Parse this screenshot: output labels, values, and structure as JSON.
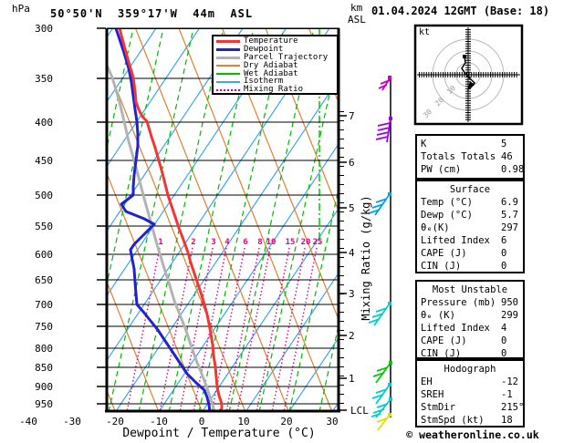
{
  "header": {
    "pressure_unit": "hPa",
    "title": "50°50'N  359°17'W  44m  ASL",
    "km_label": "km",
    "asl_label": "ASL",
    "date": "01.04.2024 12GMT (Base: 18)"
  },
  "legend": {
    "items": [
      {
        "label": "Temperature",
        "color": "#f23535"
      },
      {
        "label": "Dewpoint",
        "color": "#2222cc"
      },
      {
        "label": "Parcel Trajectory",
        "color": "#b3b3b3"
      },
      {
        "label": "Dry Adiabat",
        "color": "#e08030"
      },
      {
        "label": "Wet Adiabat",
        "color": "#00bb00"
      },
      {
        "label": "Isotherm",
        "color": "#3ba6f2"
      },
      {
        "label": "Mixing Ratio",
        "color": "#e0007d"
      }
    ]
  },
  "axes": {
    "pressure": [
      "300",
      "350",
      "400",
      "450",
      "500",
      "550",
      "600",
      "650",
      "700",
      "750",
      "800",
      "850",
      "900",
      "950"
    ],
    "temp": [
      "-40",
      "-30",
      "-20",
      "-10",
      "0",
      "10",
      "20",
      "30"
    ],
    "km": [
      "7",
      "6",
      "5",
      "4",
      "3",
      "2",
      "1"
    ],
    "lcl": "LCL",
    "mix": [
      "1",
      "2",
      "3",
      "4",
      "6",
      "8",
      "10",
      "15",
      "20",
      "25"
    ],
    "xlabel": "Dewpoint / Temperature (°C)",
    "ylabel_right": "Mixing Ratio (g/kg)"
  },
  "hodograph": {
    "unit": "kt",
    "rings": [
      "10",
      "20",
      "30"
    ]
  },
  "panels": {
    "indices": {
      "rows": [
        {
          "label": "K",
          "value": "5"
        },
        {
          "label": "Totals Totals",
          "value": "46"
        },
        {
          "label": "PW (cm)",
          "value": "0.98"
        }
      ]
    },
    "surface": {
      "title": "Surface",
      "rows": [
        {
          "label": "Temp (°C)",
          "value": "6.9"
        },
        {
          "label": "Dewp (°C)",
          "value": "5.7"
        },
        {
          "label": "θₑ(K)",
          "value": "297"
        },
        {
          "label": "Lifted Index",
          "value": "6"
        },
        {
          "label": "CAPE (J)",
          "value": "0"
        },
        {
          "label": "CIN (J)",
          "value": "0"
        }
      ]
    },
    "most_unstable": {
      "title": "Most Unstable",
      "rows": [
        {
          "label": "Pressure (mb)",
          "value": "950"
        },
        {
          "label": "θₑ (K)",
          "value": "299"
        },
        {
          "label": "Lifted Index",
          "value": "4"
        },
        {
          "label": "CAPE (J)",
          "value": "0"
        },
        {
          "label": "CIN (J)",
          "value": "0"
        }
      ]
    },
    "hodograph_stats": {
      "title": "Hodograph",
      "rows": [
        {
          "label": "EH",
          "value": "-12"
        },
        {
          "label": "SREH",
          "value": "-1"
        },
        {
          "label": "StmDir",
          "value": "215°"
        },
        {
          "label": "StmSpd (kt)",
          "value": "18"
        }
      ]
    }
  },
  "footer": {
    "copyright": "© weatheronline.co.uk"
  },
  "colors": {
    "temperature": "#f23535",
    "dewpoint": "#2222cc",
    "parcel": "#b3b3b3",
    "dry_adiabat": "#e08030",
    "wet_adiabat": "#00bb00",
    "isotherm": "#3ba6f2",
    "mixing_ratio": "#e0007d",
    "barb_magenta": "#cc00cc",
    "barb_purple": "#9900ee",
    "barb_blue": "#00a2e8",
    "barb_teal": "#00cdcd",
    "barb_green": "#00cc00",
    "barb_yellow": "#dfdf00"
  },
  "chart_data": {
    "type": "skew-t",
    "station": "50°50'N 359°17'W 44m ASL",
    "valid": "01.04.2024 12GMT (Base: 18)",
    "pressure_levels_hpa": [
      950,
      900,
      850,
      800,
      750,
      700,
      650,
      600,
      550,
      500,
      450,
      400,
      350,
      300
    ],
    "temperature_c": [
      6.9,
      4,
      1,
      -2,
      -5,
      -9,
      -13,
      -17,
      -21,
      -26,
      -31,
      -37,
      -44,
      -52
    ],
    "dewpoint_c": [
      5.7,
      2,
      -3,
      -8,
      -14,
      -19,
      -22,
      -27,
      -24,
      -33,
      -38,
      -45,
      -52,
      -60
    ],
    "mixing_ratio_lines_g_kg": [
      1,
      2,
      3,
      4,
      6,
      8,
      10,
      15,
      20,
      25
    ],
    "temp_axis_range_c": [
      -40,
      38
    ],
    "pressure_axis_range_hpa": [
      300,
      975
    ],
    "km_asl_ticks": [
      1,
      2,
      3,
      4,
      5,
      6,
      7
    ],
    "lcl_marker": "LCL at bottom right axis",
    "wind_barb_levels": [
      {
        "approx_km": 7.8,
        "color": "magenta"
      },
      {
        "approx_km": 7.0,
        "color": "purple"
      },
      {
        "approx_km": 5.3,
        "color": "blue"
      },
      {
        "approx_km": 3.2,
        "color": "teal"
      },
      {
        "approx_km": 1.7,
        "color": "green"
      },
      {
        "approx_km": 1.2,
        "color": "teal"
      },
      {
        "approx_km": 0.8,
        "color": "teal"
      },
      {
        "approx_km": 0.1,
        "color": "yellow"
      }
    ],
    "indices": {
      "K": 5,
      "TotalsTotals": 46,
      "PW_cm": 0.98,
      "surface": {
        "temp_c": 6.9,
        "dewp_c": 5.7,
        "theta_e_k": 297,
        "lifted_index": 6,
        "cape_j": 0,
        "cin_j": 0
      },
      "most_unstable": {
        "pressure_mb": 950,
        "theta_e_k": 299,
        "lifted_index": 4,
        "cape_j": 0,
        "cin_j": 0
      },
      "hodograph": {
        "EH": -12,
        "SREH": -1,
        "StmDir_deg": 215,
        "StmSpd_kt": 18
      }
    }
  }
}
